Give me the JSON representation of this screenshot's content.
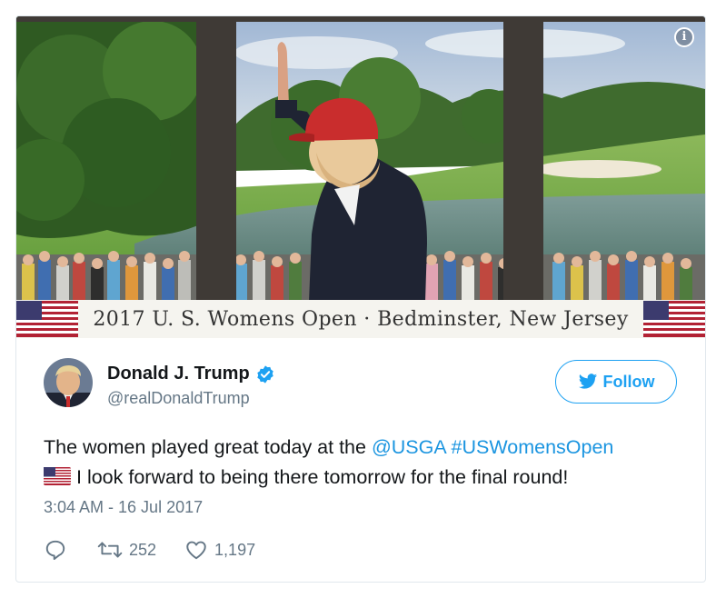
{
  "photo": {
    "banner_text": "2017 U. S. Womens Open · Bedminster, New Jersey",
    "info_icon": "info-icon"
  },
  "author": {
    "name": "Donald J. Trump",
    "handle": "@realDonaldTrump",
    "verified": true
  },
  "follow_button": {
    "label": "Follow",
    "icon": "twitter-bird-icon"
  },
  "tweet": {
    "text_before": "The women played great today at the ",
    "mention": "@USGA",
    "space": " ",
    "hashtag": "#USWomensOpen",
    "line2": "I look forward to being there tomorrow for the final round!",
    "emoji": "us-flag-emoji"
  },
  "timestamp": "3:04 AM - 16 Jul 2017",
  "actions": {
    "reply": {
      "icon": "reply-icon"
    },
    "retweet": {
      "icon": "retweet-icon",
      "count": "252"
    },
    "like": {
      "icon": "heart-icon",
      "count": "1,197"
    }
  },
  "colors": {
    "twitter_blue": "#1da1f2",
    "link_blue": "#1b95e0",
    "secondary_text": "#657786",
    "border": "#e1e8ed"
  }
}
